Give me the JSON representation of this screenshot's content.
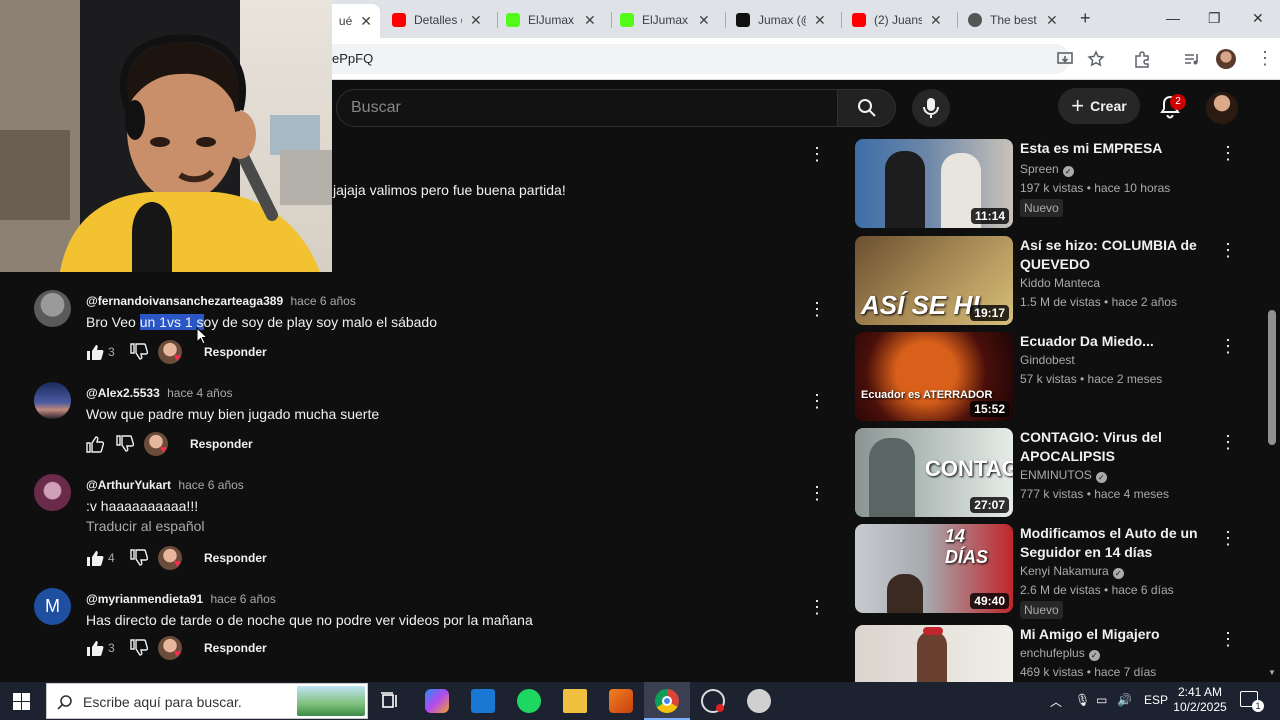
{
  "browser": {
    "tabs": [
      {
        "title": "ué",
        "favicon": "youtube-icon"
      },
      {
        "title": "Detalles d",
        "favicon": "youtube-icon"
      },
      {
        "title": "ElJumax -",
        "favicon": "kick-icon"
      },
      {
        "title": "ElJumax V",
        "favicon": "kick-icon"
      },
      {
        "title": "Jumax (@",
        "favicon": "tiktok-icon"
      },
      {
        "title": "(2) Juans",
        "favicon": "youtube-icon"
      },
      {
        "title": "The best",
        "favicon": "chatgpt-icon"
      }
    ],
    "address": "ePpFQ",
    "new_tab": "+",
    "window_controls": {
      "minimize": "—",
      "restore": "❐",
      "close": "✕"
    }
  },
  "youtube": {
    "search_placeholder": "Buscar",
    "create_label": "Crear",
    "notification_count": "2"
  },
  "comments": {
    "previous_text": "jajaja valimos pero fue buena partida!",
    "reply_label": "Responder",
    "translate_label": "Traducir al español",
    "items": [
      {
        "author": "@fernandoivansanchezarteaga389",
        "time": "hace 6 años",
        "text_before": "Bro Veo ",
        "text_selected": "un 1vs 1 s",
        "text_after": "oy de soy de play soy malo el sábado",
        "likes": "3",
        "avatar_color": "#6b6b6b"
      },
      {
        "author": "@Alex2.5533",
        "time": "hace 4 años",
        "text": "Wow que padre muy bien jugado mucha suerte",
        "likes": "",
        "avatar_color": "#3a4a7a"
      },
      {
        "author": "@ArthurYukart",
        "time": "hace 6 años",
        "text": ":v haaaaaaaaaa!!!",
        "likes": "4",
        "avatar_color": "#7a3c5a"
      },
      {
        "author": "@myrianmendieta91",
        "time": "hace 6 años",
        "text": "Has directo de tarde o de noche que no podre ver videos por la mañana",
        "likes": "3",
        "avatar_letter": "M",
        "avatar_color": "#1e4fa0"
      }
    ]
  },
  "recommendations": [
    {
      "title": "Esta es mi EMPRESA",
      "channel": "Spreen",
      "verified": true,
      "meta": "197 k vistas • hace 10 horas",
      "badge": "Nuevo",
      "duration": "11:14",
      "thumb_colors": [
        "#3d6ea8",
        "#c9c2b8"
      ]
    },
    {
      "title": "Así se hizo: COLUMBIA de QUEVEDO",
      "channel": "Kiddo Manteca",
      "verified": false,
      "meta": "1.5 M de vistas • hace 2 años",
      "badge": "",
      "duration": "19:17",
      "thumb_text": "ASÍ SE HI",
      "thumb_colors": [
        "#8a6a3a",
        "#d8c07a"
      ]
    },
    {
      "title": "Ecuador Da Miedo...",
      "channel": "Gindobest",
      "verified": false,
      "meta": "57 k vistas • hace 2 meses",
      "badge": "",
      "duration": "15:52",
      "thumb_text": "Ecuador es ATERRADOR",
      "thumb_colors": [
        "#3a0a0a",
        "#b83a12"
      ]
    },
    {
      "title": "CONTAGIO: Virus del APOCALIPSIS",
      "channel": "ENMINUTOS",
      "verified": true,
      "meta": "777 k vistas • hace 4 meses",
      "badge": "",
      "duration": "27:07",
      "thumb_text": "CONTAGIO",
      "thumb_colors": [
        "#9aa7a5",
        "#e7ece8"
      ]
    },
    {
      "title": "Modificamos el Auto de un Seguidor en 14 días",
      "channel": "Kenyi Nakamura",
      "verified": true,
      "meta": "2.6 M de vistas • hace 6 días",
      "badge": "Nuevo",
      "duration": "49:40",
      "thumb_text": "14 DÍAS",
      "thumb_colors": [
        "#b8bcc0",
        "#c0262b"
      ]
    },
    {
      "title": "Mi Amigo el Migajero",
      "channel": "enchufeplus",
      "verified": true,
      "meta": "469 k vistas • hace 7 días",
      "badge": "",
      "duration": "",
      "thumb_colors": [
        "#d9d4cc",
        "#f1eee9"
      ]
    }
  ],
  "taskbar": {
    "search_placeholder": "Escribe aquí para buscar.",
    "language": "ESP",
    "time": "2:41 AM",
    "date": "10/2/2025",
    "notification_count": "1"
  },
  "colors": {
    "youtube_bg": "#0f0f0f",
    "selection": "#2a57c5",
    "youtube_red": "#ff0000",
    "kick_green": "#53fc18"
  }
}
